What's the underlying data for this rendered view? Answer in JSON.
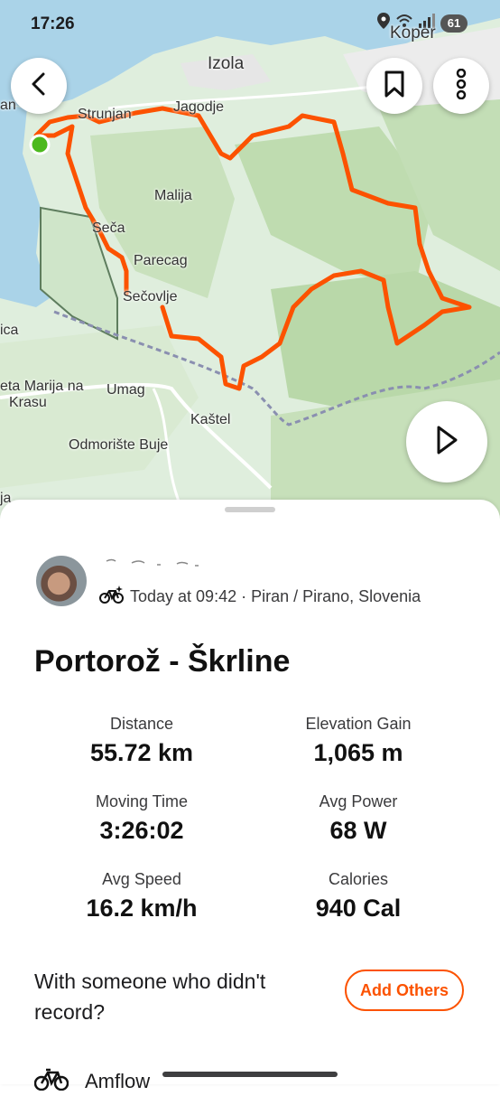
{
  "status_bar": {
    "time": "17:26",
    "battery": "61"
  },
  "map": {
    "labels": [
      "Koper",
      "Izola",
      "Strunjan",
      "Jagodje",
      "Malija",
      "Sečа",
      "Parecag",
      "Sečovlje",
      "Umag",
      "Kaštel",
      "Odmorište Buje",
      "eta Marija na",
      "Krasu",
      "ica",
      "an",
      "ja"
    ],
    "colors": {
      "route": "#fc5200",
      "start_marker": "#4cb91e",
      "sea": "#aad3e8",
      "land": "#d4e6cc",
      "forest": "#b7d7a8"
    },
    "icons": {
      "back": "chevron-left-icon",
      "bookmark": "bookmark-icon",
      "more": "more-vertical-icon",
      "play": "play-icon"
    }
  },
  "activity": {
    "athlete_name_obscured": "",
    "activity_type_icon": "bike-sparkle-icon",
    "meta": "Today at 09:42 · Piran / Pirano, Slovenia",
    "title": "Portorož - Škrline",
    "stats": [
      {
        "label": "Distance",
        "value": "55.72 km"
      },
      {
        "label": "Elevation Gain",
        "value": "1,065 m"
      },
      {
        "label": "Moving Time",
        "value": "3:26:02"
      },
      {
        "label": "Avg Power",
        "value": "68 W"
      },
      {
        "label": "Avg Speed",
        "value": "16.2 km/h"
      },
      {
        "label": "Calories",
        "value": "940 Cal"
      }
    ],
    "with_others_question": "With someone who didn't record?",
    "add_others_label": "Add Others",
    "gear_label": "Amflow"
  }
}
